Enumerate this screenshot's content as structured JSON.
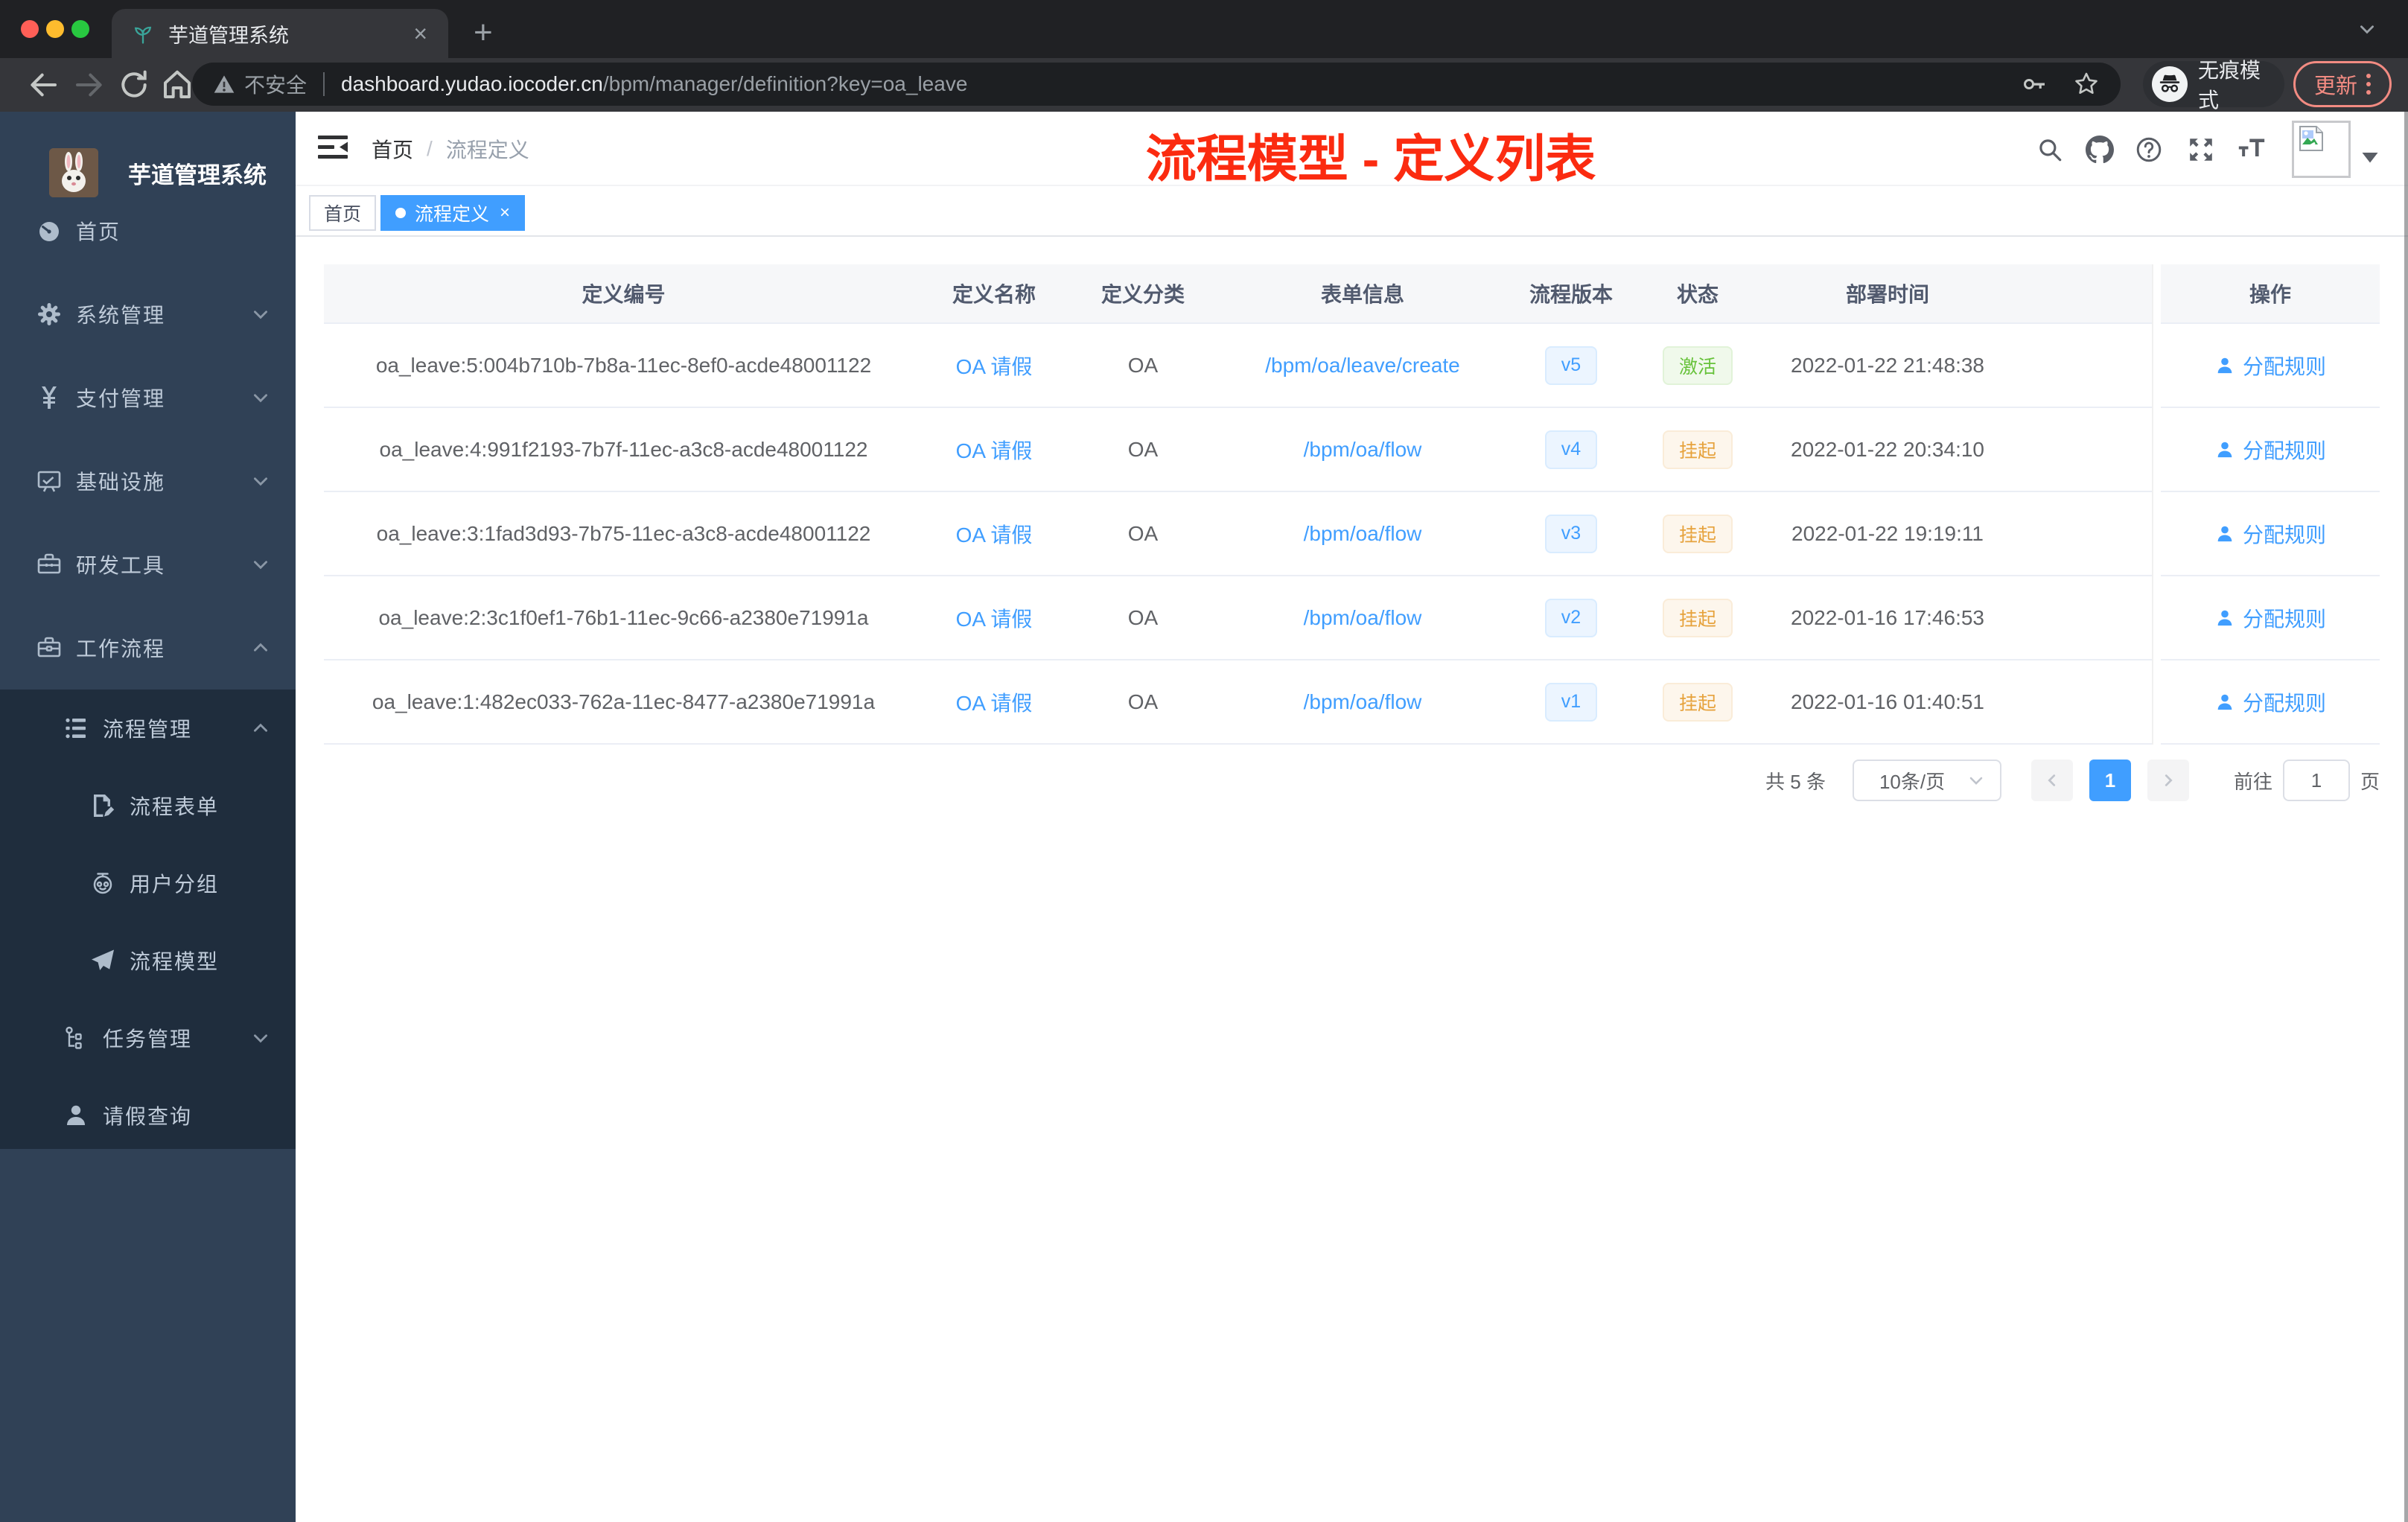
{
  "colors": {
    "accent": "#409eff",
    "success": "#67c23a",
    "warning": "#e6a23c",
    "annotation_red": "#fb2b10",
    "sidebar_bg": "#304156",
    "submenu_bg": "#1f2d3d",
    "browser_dark": "#202124",
    "browser_toolbar": "#35363a",
    "traffic_red": "#ff5f57",
    "traffic_yellow": "#febc2e",
    "traffic_green": "#28c840"
  },
  "browser": {
    "tab_title": "芋道管理系统",
    "security_label": "不安全",
    "url_domain": "dashboard.yudao.iocoder.cn",
    "url_path": "/bpm/manager/definition?key=oa_leave",
    "incognito_label": "无痕模式",
    "update_label": "更新"
  },
  "sidebar": {
    "logo_title": "芋道管理系统",
    "items": [
      {
        "label": "首页",
        "icon": "dashboard-icon",
        "level": 1,
        "arrow": null
      },
      {
        "label": "系统管理",
        "icon": "gear-icon",
        "level": 1,
        "arrow": "down"
      },
      {
        "label": "支付管理",
        "icon": "yen-icon",
        "level": 1,
        "arrow": "down"
      },
      {
        "label": "基础设施",
        "icon": "monitor-icon",
        "level": 1,
        "arrow": "down"
      },
      {
        "label": "研发工具",
        "icon": "toolbox-icon",
        "level": 1,
        "arrow": "down"
      },
      {
        "label": "工作流程",
        "icon": "briefcase-icon",
        "level": 1,
        "arrow": "up"
      },
      {
        "label": "流程管理",
        "icon": "tree-list-icon",
        "level": 2,
        "arrow": "up"
      },
      {
        "label": "流程表单",
        "icon": "form-doc-icon",
        "level": 3,
        "arrow": null
      },
      {
        "label": "用户分组",
        "icon": "robot-icon",
        "level": 3,
        "arrow": null
      },
      {
        "label": "流程模型",
        "icon": "paper-plane-icon",
        "level": 3,
        "arrow": null
      },
      {
        "label": "任务管理",
        "icon": "task-tree-icon",
        "level": 2,
        "arrow": "down"
      },
      {
        "label": "请假查询",
        "icon": "user-icon",
        "level": 2,
        "arrow": null
      }
    ]
  },
  "header": {
    "breadcrumb": [
      "首页",
      "流程定义"
    ],
    "breadcrumb_separator": "/",
    "annotation": "流程模型 - 定义列表",
    "icons": [
      "search-icon",
      "github-icon",
      "help-icon",
      "fullscreen-icon",
      "font-size-icon"
    ]
  },
  "tags": [
    {
      "label": "首页",
      "active": false
    },
    {
      "label": "流程定义",
      "active": true
    }
  ],
  "table": {
    "columns": [
      "定义编号",
      "定义名称",
      "定义分类",
      "表单信息",
      "流程版本",
      "状态",
      "部署时间",
      "操作"
    ],
    "rows": [
      {
        "id": "oa_leave:5:004b710b-7b8a-11ec-8ef0-acde48001122",
        "name": "OA 请假",
        "category": "OA",
        "form": "/bpm/oa/leave/create",
        "version": "v5",
        "status": "激活",
        "status_type": "success",
        "time": "2022-01-22 21:48:38",
        "action": "分配规则"
      },
      {
        "id": "oa_leave:4:991f2193-7b7f-11ec-a3c8-acde48001122",
        "name": "OA 请假",
        "category": "OA",
        "form": "/bpm/oa/flow",
        "version": "v4",
        "status": "挂起",
        "status_type": "warning",
        "time": "2022-01-22 20:34:10",
        "action": "分配规则"
      },
      {
        "id": "oa_leave:3:1fad3d93-7b75-11ec-a3c8-acde48001122",
        "name": "OA 请假",
        "category": "OA",
        "form": "/bpm/oa/flow",
        "version": "v3",
        "status": "挂起",
        "status_type": "warning",
        "time": "2022-01-22 19:19:11",
        "action": "分配规则"
      },
      {
        "id": "oa_leave:2:3c1f0ef1-76b1-11ec-9c66-a2380e71991a",
        "name": "OA 请假",
        "category": "OA",
        "form": "/bpm/oa/flow",
        "version": "v2",
        "status": "挂起",
        "status_type": "warning",
        "time": "2022-01-16 17:46:53",
        "action": "分配规则"
      },
      {
        "id": "oa_leave:1:482ec033-762a-11ec-8477-a2380e71991a",
        "name": "OA 请假",
        "category": "OA",
        "form": "/bpm/oa/flow",
        "version": "v1",
        "status": "挂起",
        "status_type": "warning",
        "time": "2022-01-16 01:40:51",
        "action": "分配规则"
      }
    ]
  },
  "pagination": {
    "total_label": "共 5 条",
    "page_size": "10条/页",
    "current_page": "1",
    "goto_label": "前往",
    "goto_value": "1",
    "page_label": "页"
  }
}
